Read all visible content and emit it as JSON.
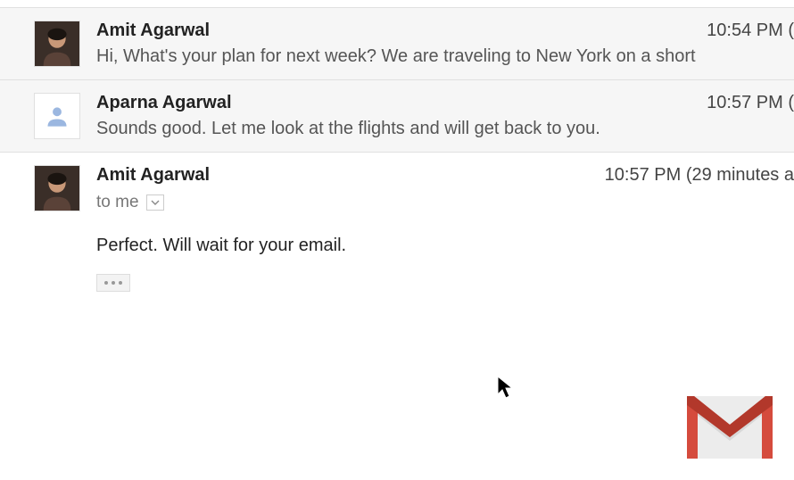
{
  "messages": [
    {
      "sender": "Amit Agarwal",
      "time": "10:54 PM (",
      "snippet": "Hi, What's your plan for next week? We are traveling to New York on a short",
      "avatar_type": "photo"
    },
    {
      "sender": "Aparna Agarwal",
      "time": "10:57 PM (",
      "snippet": "Sounds good. Let me look at the flights and will get back to you.",
      "avatar_type": "placeholder"
    },
    {
      "sender": "Amit Agarwal",
      "time": "10:57 PM (29 minutes a",
      "recipient": "to me",
      "body": "Perfect. Will wait for your email.",
      "avatar_type": "photo"
    }
  ]
}
